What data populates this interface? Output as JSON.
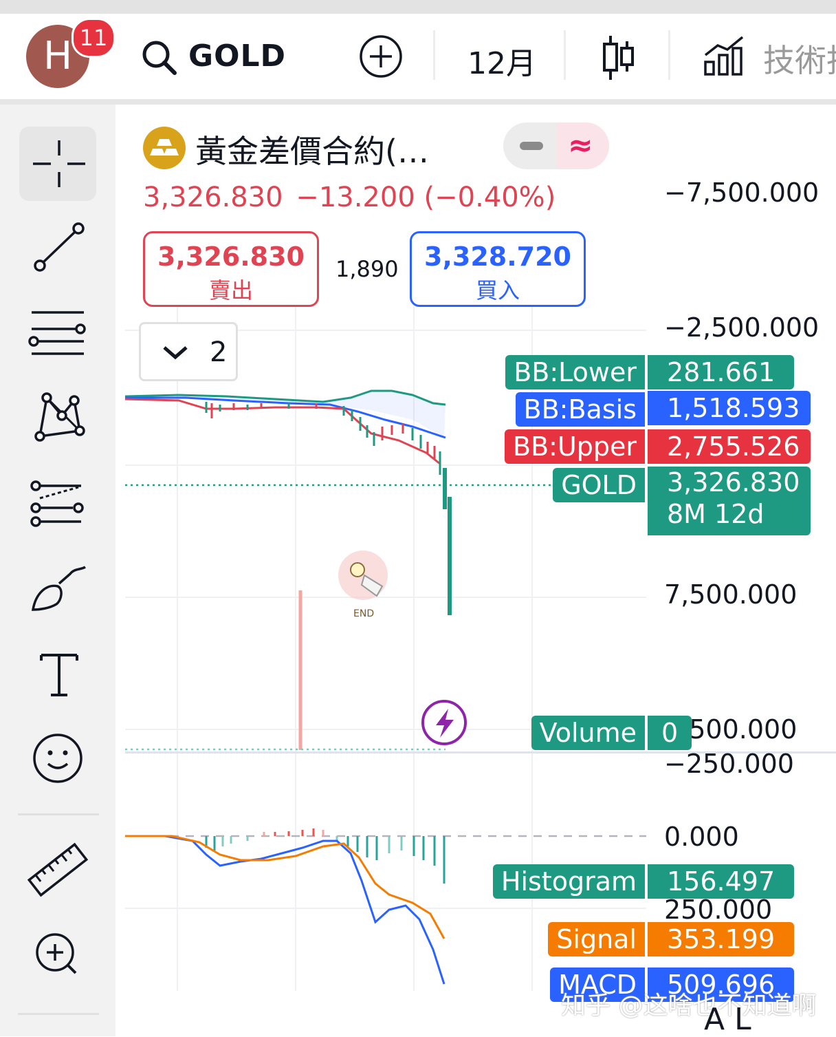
{
  "header": {
    "avatar_letter": "H",
    "notification_count": "11",
    "symbol": "GOLD",
    "interval": "12月",
    "indicators_label": "技術指",
    "icons": [
      "search-icon",
      "plus-circle-icon",
      "candlestick-icon",
      "indicators-chart-icon"
    ]
  },
  "toolbar": {
    "tools": [
      "crosshair-icon",
      "trendline-icon",
      "parallel-lines-icon",
      "pattern-icon",
      "fib-icon",
      "brush-icon",
      "text-icon",
      "emoji-icon",
      "ruler-icon",
      "zoom-in-icon"
    ]
  },
  "instrument": {
    "title": "黃金差價合約(…",
    "last": "3,326.830",
    "change": "−13.200",
    "change_pct": "(−0.40%)"
  },
  "trade": {
    "sell_price": "3,326.830",
    "sell_label": "賣出",
    "buy_price": "3,328.720",
    "buy_label": "買入",
    "spread": "1,890"
  },
  "dropdown": {
    "count": "2"
  },
  "price_axis": [
    "−7,500.000",
    "−2,500.000",
    "7,500.000",
    "1,500.000"
  ],
  "price_tags": [
    {
      "name": "BB:Lower",
      "value": "281.661",
      "color": "#1e9a83"
    },
    {
      "name": "BB:Basis",
      "value": "1,518.593",
      "color": "#2962ff"
    },
    {
      "name": "BB:Upper",
      "value": "2,755.526",
      "color": "#f23645"
    },
    {
      "name": "GOLD",
      "value": "3,326.830",
      "extra": "8M 12d",
      "color": "#1e9a83"
    },
    {
      "name": "Volume",
      "value": "0",
      "color": "#1e9a83"
    }
  ],
  "macd_axis": [
    "−250.000",
    "0.000",
    "250.000"
  ],
  "macd_tags": [
    {
      "name": "Histogram",
      "value": "156.497",
      "color": "#1e9a83"
    },
    {
      "name": "Signal",
      "value": "353.199",
      "color": "#f57c00"
    },
    {
      "name": "MACD",
      "value": "509.696",
      "color": "#2962ff"
    }
  ],
  "end_label": "END",
  "watermark": "知乎 @这啥也不知道啊",
  "bottom_letters": "A   L"
}
